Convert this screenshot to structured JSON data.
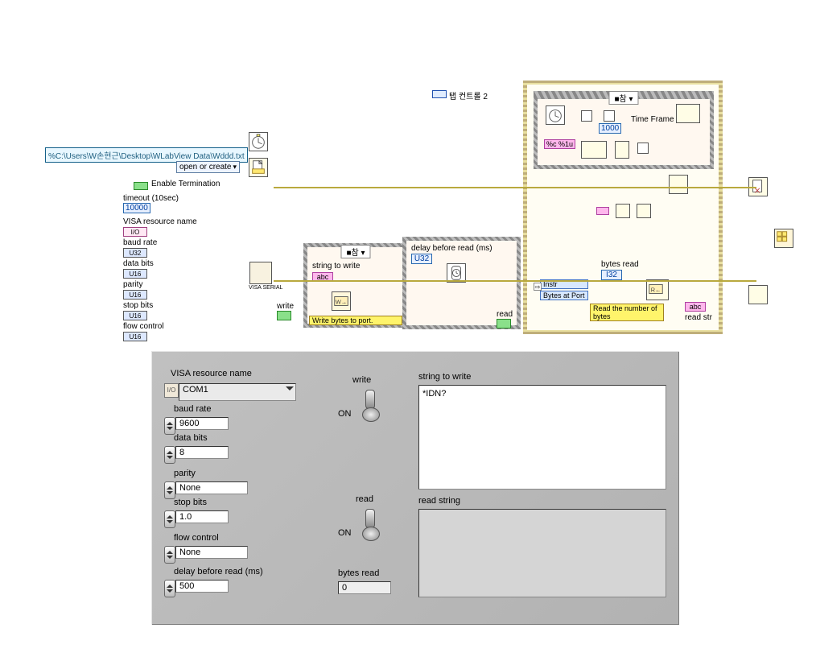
{
  "block_diagram": {
    "file_path": "%C:\\Users\\W손현근\\Desktop\\WLabView Data\\Wddd.txt",
    "open_mode": "open or create",
    "enable_termination_label": "Enable Termination",
    "timeout_label": "timeout (10sec)",
    "timeout_value": "10000",
    "controls": [
      {
        "label": "VISA resource name",
        "tag": "I/O"
      },
      {
        "label": "baud rate",
        "tag": "U32"
      },
      {
        "label": "data bits",
        "tag": "U16"
      },
      {
        "label": "parity",
        "tag": "U16"
      },
      {
        "label": "stop bits",
        "tag": "U16"
      },
      {
        "label": "flow control",
        "tag": "U16"
      }
    ],
    "serial_cfg_node": "VISA\nSERIAL",
    "write_switch_label": "write",
    "read_switch_label": "read",
    "tab_control_label": "탭 컨트롤 2",
    "frame1": {
      "selector": "■참   ▾",
      "string_to_write_label": "string to write",
      "tip": "Write bytes to port."
    },
    "frame2": {
      "delay_label": "delay before read (ms)",
      "delay_tag": "U32"
    },
    "loop": {
      "selector": "■참   ▾",
      "time_constant": "1000",
      "time_frame_label": "Time Frame",
      "format_str": "%c %1u",
      "instr_property": "Instr",
      "bytes_at_port": "Bytes at Port",
      "bytes_read_label": "bytes read",
      "bytes_read_tag": "I32",
      "tip": "Read the number of bytes",
      "read_string_label": "read str"
    }
  },
  "front_panel": {
    "visa_label": "VISA resource name",
    "visa_value": "COM1",
    "baud_label": "baud rate",
    "baud_value": "9600",
    "databits_label": "data bits",
    "databits_value": "8",
    "parity_label": "parity",
    "parity_value": "None",
    "stopbits_label": "stop bits",
    "stopbits_value": "1.0",
    "flow_label": "flow control",
    "flow_value": "None",
    "delay_label": "delay before read (ms)",
    "delay_value": "500",
    "write_switch": "write",
    "write_state": "ON",
    "read_switch": "read",
    "read_state": "ON",
    "bytes_read_label": "bytes read",
    "bytes_read_value": "0",
    "string_to_write_label": "string to write",
    "string_to_write_value": "*IDN?",
    "read_string_label": "read string",
    "read_string_value": ""
  }
}
